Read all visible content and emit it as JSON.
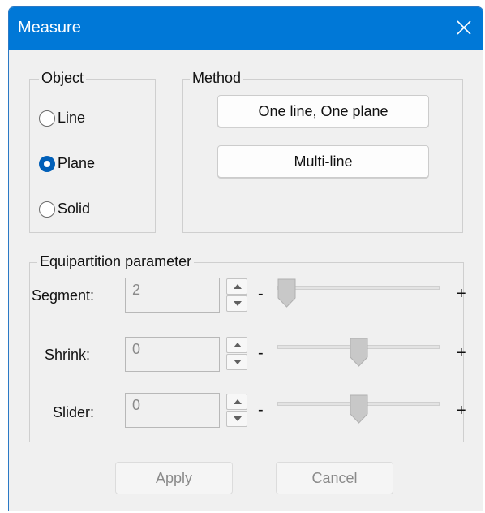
{
  "window": {
    "title": "Measure"
  },
  "object_group": {
    "legend": "Object",
    "options": [
      {
        "label": "Line",
        "checked": false
      },
      {
        "label": "Plane",
        "checked": true
      },
      {
        "label": "Solid",
        "checked": false
      }
    ]
  },
  "method_group": {
    "legend": "Method",
    "buttons": [
      "One line, One plane",
      "Multi-line"
    ]
  },
  "equipartition": {
    "legend": "Equipartition parameter",
    "rows": [
      {
        "label": "Segment:",
        "value": "2",
        "minus": "-",
        "plus": "+",
        "slider_position": 0.0
      },
      {
        "label": "Shrink:",
        "value": "0",
        "minus": "-",
        "plus": "+",
        "slider_position": 0.5
      },
      {
        "label": "Slider:",
        "value": "0",
        "minus": "-",
        "plus": "+",
        "slider_position": 0.5
      }
    ]
  },
  "footer": {
    "apply_label": "Apply",
    "cancel_label": "Cancel",
    "apply_enabled": false,
    "cancel_enabled": false
  },
  "colors": {
    "titlebar": "#0078d7",
    "radio_checked": "#005fb8"
  }
}
